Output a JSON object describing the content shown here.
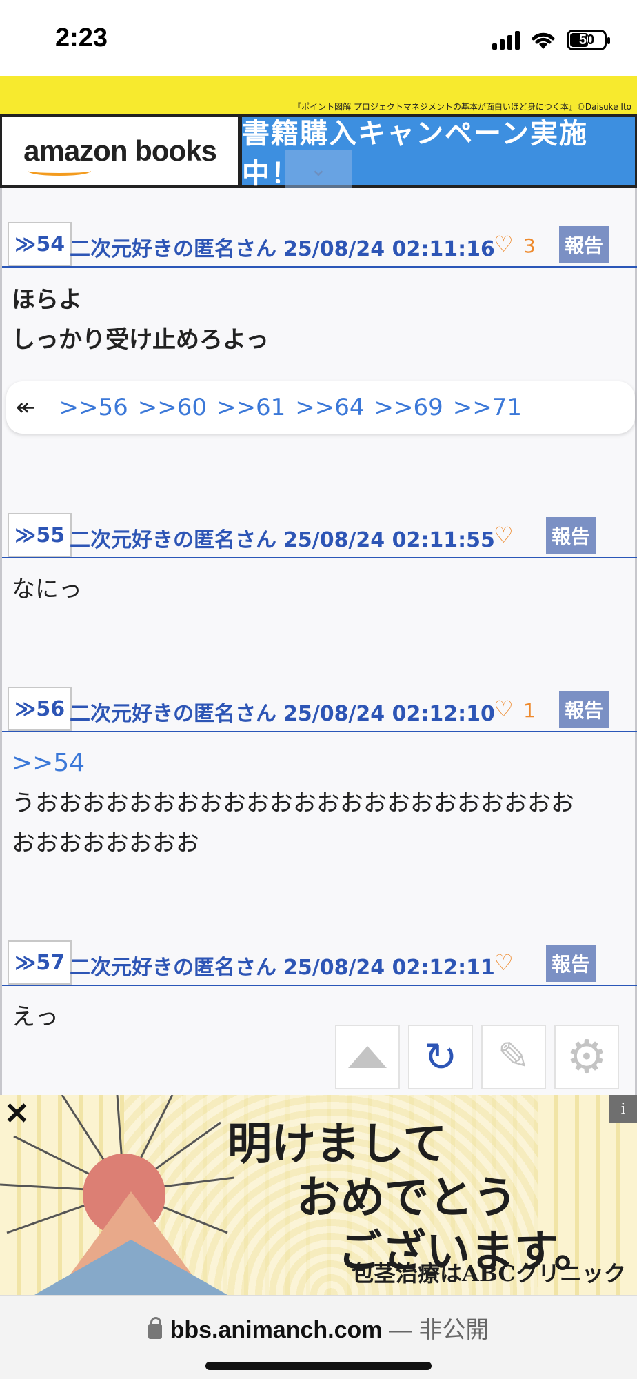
{
  "status_bar": {
    "time": "2:23",
    "battery": "50"
  },
  "top_banner": {
    "credit": "『ポイント図解 プロジェクトマネジメントの基本が面白いほど身につく本』©Daisuke Ito",
    "amazon_label": "amazon books",
    "campaign_label": "書籍購入キャンペーン実施中！"
  },
  "posts": [
    {
      "number": "≫54",
      "author": "二次元好きの匿名さん",
      "date": "25/08/24 02:11:16",
      "likes": "3",
      "report": "報告",
      "lines": [
        "ほらよ",
        "しっかり受け止めろよっ"
      ],
      "replies": [
        ">>56",
        ">>60",
        ">>61",
        ">>64",
        ">>69",
        ">>71"
      ]
    },
    {
      "number": "≫55",
      "author": "二次元好きの匿名さん",
      "date": "25/08/24 02:11:55",
      "likes": "",
      "report": "報告",
      "lines": [
        "なにっ"
      ]
    },
    {
      "number": "≫56",
      "author": "二次元好きの匿名さん",
      "date": "25/08/24 02:12:10",
      "likes": "1",
      "report": "報告",
      "anchor": ">>54",
      "lines": [
        "うおおおおおおおおおおおおおおおおおおおおおおお",
        "おおおおおおおお"
      ]
    },
    {
      "number": "≫57",
      "author": "二次元好きの匿名さん",
      "date": "25/08/24 02:12:11",
      "likes": "",
      "report": "報告",
      "lines": [
        "えっ"
      ]
    }
  ],
  "floating_buttons": {
    "icons": [
      "scroll-top-icon",
      "reload-icon",
      "edit-icon",
      "settings-icon"
    ]
  },
  "bottom_ad": {
    "line1": "明けまして",
    "line2": "おめでとう",
    "line3": "ございます。",
    "clinic": "包茎治療はABCクリニック",
    "close": "✕",
    "info": "i"
  },
  "url_bar": {
    "domain": "bbs.animanch.com",
    "separator": " — ",
    "status": "非公開"
  },
  "colors": {
    "accent_blue": "#2d55b5",
    "link_blue": "#3b78d8",
    "heart_orange": "#ee8a2d",
    "report_bg": "#7b90c4"
  }
}
